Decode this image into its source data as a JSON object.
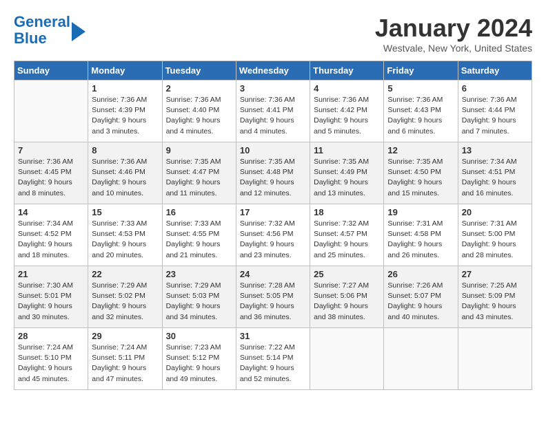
{
  "header": {
    "logo_line1": "General",
    "logo_line2": "Blue",
    "title": "January 2024",
    "location": "Westvale, New York, United States"
  },
  "days_of_week": [
    "Sunday",
    "Monday",
    "Tuesday",
    "Wednesday",
    "Thursday",
    "Friday",
    "Saturday"
  ],
  "weeks": [
    [
      {
        "day": "",
        "sunrise": "",
        "sunset": "",
        "daylight": ""
      },
      {
        "day": "1",
        "sunrise": "Sunrise: 7:36 AM",
        "sunset": "Sunset: 4:39 PM",
        "daylight": "Daylight: 9 hours and 3 minutes."
      },
      {
        "day": "2",
        "sunrise": "Sunrise: 7:36 AM",
        "sunset": "Sunset: 4:40 PM",
        "daylight": "Daylight: 9 hours and 4 minutes."
      },
      {
        "day": "3",
        "sunrise": "Sunrise: 7:36 AM",
        "sunset": "Sunset: 4:41 PM",
        "daylight": "Daylight: 9 hours and 4 minutes."
      },
      {
        "day": "4",
        "sunrise": "Sunrise: 7:36 AM",
        "sunset": "Sunset: 4:42 PM",
        "daylight": "Daylight: 9 hours and 5 minutes."
      },
      {
        "day": "5",
        "sunrise": "Sunrise: 7:36 AM",
        "sunset": "Sunset: 4:43 PM",
        "daylight": "Daylight: 9 hours and 6 minutes."
      },
      {
        "day": "6",
        "sunrise": "Sunrise: 7:36 AM",
        "sunset": "Sunset: 4:44 PM",
        "daylight": "Daylight: 9 hours and 7 minutes."
      }
    ],
    [
      {
        "day": "7",
        "sunrise": "Sunrise: 7:36 AM",
        "sunset": "Sunset: 4:45 PM",
        "daylight": "Daylight: 9 hours and 8 minutes."
      },
      {
        "day": "8",
        "sunrise": "Sunrise: 7:36 AM",
        "sunset": "Sunset: 4:46 PM",
        "daylight": "Daylight: 9 hours and 10 minutes."
      },
      {
        "day": "9",
        "sunrise": "Sunrise: 7:35 AM",
        "sunset": "Sunset: 4:47 PM",
        "daylight": "Daylight: 9 hours and 11 minutes."
      },
      {
        "day": "10",
        "sunrise": "Sunrise: 7:35 AM",
        "sunset": "Sunset: 4:48 PM",
        "daylight": "Daylight: 9 hours and 12 minutes."
      },
      {
        "day": "11",
        "sunrise": "Sunrise: 7:35 AM",
        "sunset": "Sunset: 4:49 PM",
        "daylight": "Daylight: 9 hours and 13 minutes."
      },
      {
        "day": "12",
        "sunrise": "Sunrise: 7:35 AM",
        "sunset": "Sunset: 4:50 PM",
        "daylight": "Daylight: 9 hours and 15 minutes."
      },
      {
        "day": "13",
        "sunrise": "Sunrise: 7:34 AM",
        "sunset": "Sunset: 4:51 PM",
        "daylight": "Daylight: 9 hours and 16 minutes."
      }
    ],
    [
      {
        "day": "14",
        "sunrise": "Sunrise: 7:34 AM",
        "sunset": "Sunset: 4:52 PM",
        "daylight": "Daylight: 9 hours and 18 minutes."
      },
      {
        "day": "15",
        "sunrise": "Sunrise: 7:33 AM",
        "sunset": "Sunset: 4:53 PM",
        "daylight": "Daylight: 9 hours and 20 minutes."
      },
      {
        "day": "16",
        "sunrise": "Sunrise: 7:33 AM",
        "sunset": "Sunset: 4:55 PM",
        "daylight": "Daylight: 9 hours and 21 minutes."
      },
      {
        "day": "17",
        "sunrise": "Sunrise: 7:32 AM",
        "sunset": "Sunset: 4:56 PM",
        "daylight": "Daylight: 9 hours and 23 minutes."
      },
      {
        "day": "18",
        "sunrise": "Sunrise: 7:32 AM",
        "sunset": "Sunset: 4:57 PM",
        "daylight": "Daylight: 9 hours and 25 minutes."
      },
      {
        "day": "19",
        "sunrise": "Sunrise: 7:31 AM",
        "sunset": "Sunset: 4:58 PM",
        "daylight": "Daylight: 9 hours and 26 minutes."
      },
      {
        "day": "20",
        "sunrise": "Sunrise: 7:31 AM",
        "sunset": "Sunset: 5:00 PM",
        "daylight": "Daylight: 9 hours and 28 minutes."
      }
    ],
    [
      {
        "day": "21",
        "sunrise": "Sunrise: 7:30 AM",
        "sunset": "Sunset: 5:01 PM",
        "daylight": "Daylight: 9 hours and 30 minutes."
      },
      {
        "day": "22",
        "sunrise": "Sunrise: 7:29 AM",
        "sunset": "Sunset: 5:02 PM",
        "daylight": "Daylight: 9 hours and 32 minutes."
      },
      {
        "day": "23",
        "sunrise": "Sunrise: 7:29 AM",
        "sunset": "Sunset: 5:03 PM",
        "daylight": "Daylight: 9 hours and 34 minutes."
      },
      {
        "day": "24",
        "sunrise": "Sunrise: 7:28 AM",
        "sunset": "Sunset: 5:05 PM",
        "daylight": "Daylight: 9 hours and 36 minutes."
      },
      {
        "day": "25",
        "sunrise": "Sunrise: 7:27 AM",
        "sunset": "Sunset: 5:06 PM",
        "daylight": "Daylight: 9 hours and 38 minutes."
      },
      {
        "day": "26",
        "sunrise": "Sunrise: 7:26 AM",
        "sunset": "Sunset: 5:07 PM",
        "daylight": "Daylight: 9 hours and 40 minutes."
      },
      {
        "day": "27",
        "sunrise": "Sunrise: 7:25 AM",
        "sunset": "Sunset: 5:09 PM",
        "daylight": "Daylight: 9 hours and 43 minutes."
      }
    ],
    [
      {
        "day": "28",
        "sunrise": "Sunrise: 7:24 AM",
        "sunset": "Sunset: 5:10 PM",
        "daylight": "Daylight: 9 hours and 45 minutes."
      },
      {
        "day": "29",
        "sunrise": "Sunrise: 7:24 AM",
        "sunset": "Sunset: 5:11 PM",
        "daylight": "Daylight: 9 hours and 47 minutes."
      },
      {
        "day": "30",
        "sunrise": "Sunrise: 7:23 AM",
        "sunset": "Sunset: 5:12 PM",
        "daylight": "Daylight: 9 hours and 49 minutes."
      },
      {
        "day": "31",
        "sunrise": "Sunrise: 7:22 AM",
        "sunset": "Sunset: 5:14 PM",
        "daylight": "Daylight: 9 hours and 52 minutes."
      },
      {
        "day": "",
        "sunrise": "",
        "sunset": "",
        "daylight": ""
      },
      {
        "day": "",
        "sunrise": "",
        "sunset": "",
        "daylight": ""
      },
      {
        "day": "",
        "sunrise": "",
        "sunset": "",
        "daylight": ""
      }
    ]
  ]
}
